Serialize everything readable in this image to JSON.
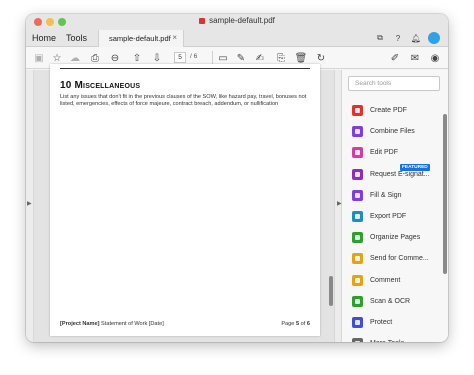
{
  "window": {
    "title": "sample-default.pdf"
  },
  "tabs": {
    "home": "Home",
    "tools": "Tools",
    "document": "sample-default.pdf",
    "close": "×"
  },
  "toolbar": {
    "current_page": "5",
    "page_total": "/ 6"
  },
  "document": {
    "section_number": "10",
    "section_title": "Miscellaneous",
    "body": "List any issues that don't fit in the previous clauses of the SOW, like hazard pay, travel, bonuses not listed, emergencies, effects of force majeure, contract breach, addendum, or nullification",
    "footer_left_bold": "[Project Name]",
    "footer_left": "Statement of Work [Date]",
    "footer_right_prefix": "Page",
    "footer_page": "5",
    "footer_of": "of",
    "footer_total": "6"
  },
  "panel": {
    "search_placeholder": "Search tools",
    "featured_badge": "FEATURED",
    "tools": [
      {
        "label": "Create PDF",
        "icon": "create-pdf-icon",
        "color": "#e0332b"
      },
      {
        "label": "Combine Files",
        "icon": "combine-files-icon",
        "color": "#7b3fe4"
      },
      {
        "label": "Edit PDF",
        "icon": "edit-pdf-icon",
        "color": "#d43ca1"
      },
      {
        "label": "Request E-signat...",
        "icon": "request-esign-icon",
        "color": "#8f2db8"
      },
      {
        "label": "Fill & Sign",
        "icon": "fill-sign-icon",
        "color": "#7b3fe4"
      },
      {
        "label": "Export PDF",
        "icon": "export-pdf-icon",
        "color": "#1e8fb5"
      },
      {
        "label": "Organize Pages",
        "icon": "organize-pages-icon",
        "color": "#2f9f2f"
      },
      {
        "label": "Send for Comme...",
        "icon": "send-comment-icon",
        "color": "#e3a414"
      },
      {
        "label": "Comment",
        "icon": "comment-icon",
        "color": "#e3a414"
      },
      {
        "label": "Scan & OCR",
        "icon": "scan-ocr-icon",
        "color": "#2f9f2f"
      },
      {
        "label": "Protect",
        "icon": "protect-icon",
        "color": "#3d4fd6"
      },
      {
        "label": "More Tools",
        "icon": "more-tools-icon",
        "color": "#666666"
      }
    ]
  }
}
